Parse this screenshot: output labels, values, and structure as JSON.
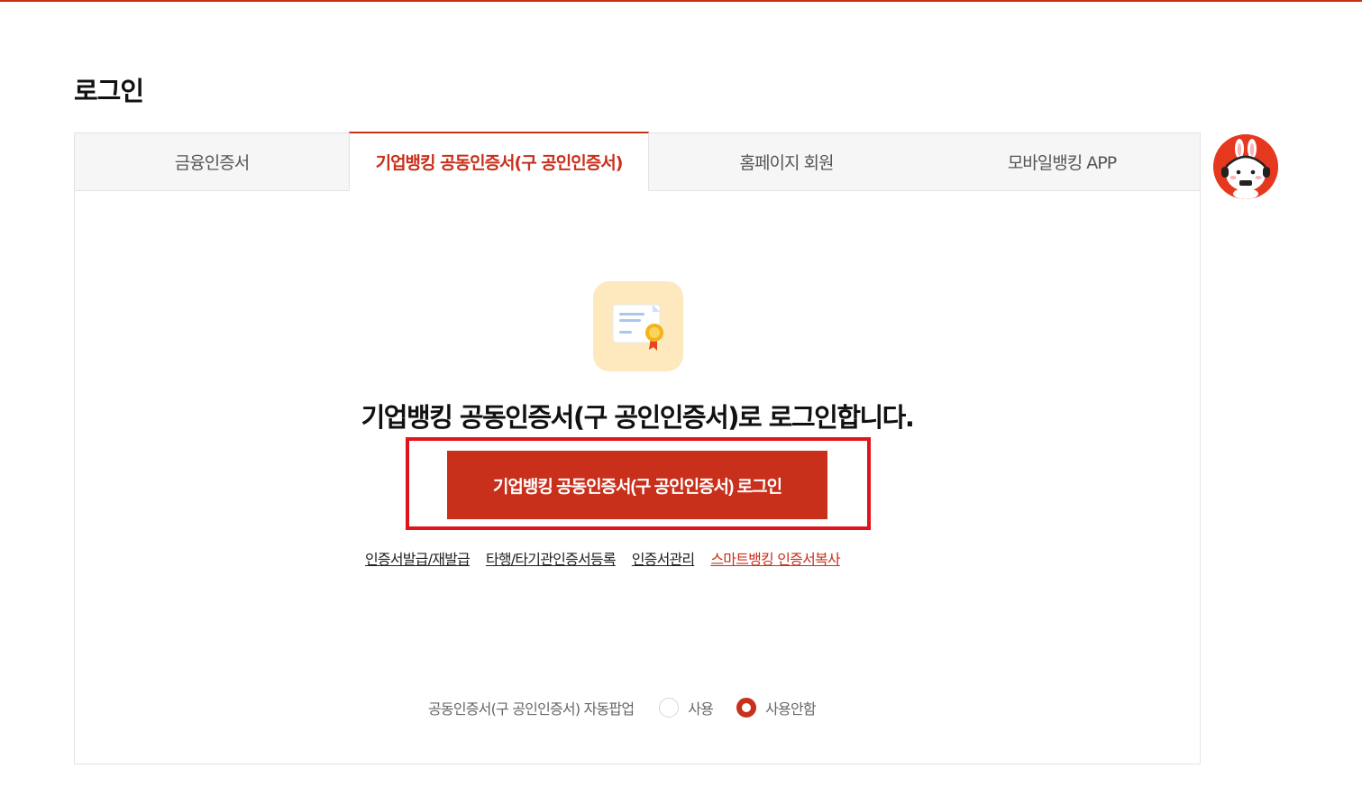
{
  "page": {
    "title": "로그인"
  },
  "tabs": [
    {
      "label": "금융인증서",
      "active": false
    },
    {
      "label": "기업뱅킹 공동인증서(구 공인인증서)",
      "active": true
    },
    {
      "label": "홈페이지 회원",
      "active": false
    },
    {
      "label": "모바일뱅킹 APP",
      "active": false
    }
  ],
  "main": {
    "icon": "certificate-icon",
    "headline": "기업뱅킹 공동인증서(구 공인인증서)로 로그인합니다.",
    "login_button": "기업뱅킹 공동인증서(구 공인인증서) 로그인"
  },
  "links": [
    {
      "label": "인증서발급/재발급"
    },
    {
      "label": "타행/타기관인증서등록"
    },
    {
      "label": "인증서관리"
    },
    {
      "label": "스마트뱅킹 인증서복사"
    }
  ],
  "auto_popup": {
    "label": "공동인증서(구 공인인증서) 자동팝업",
    "options": [
      {
        "label": "사용",
        "selected": false
      },
      {
        "label": "사용안함",
        "selected": true
      }
    ]
  },
  "colors": {
    "accent": "#c9301c",
    "highlight_frame": "#e0141c",
    "icon_bg": "#fde9bd"
  },
  "mascot": {
    "icon": "rabbit-mascot-icon"
  }
}
